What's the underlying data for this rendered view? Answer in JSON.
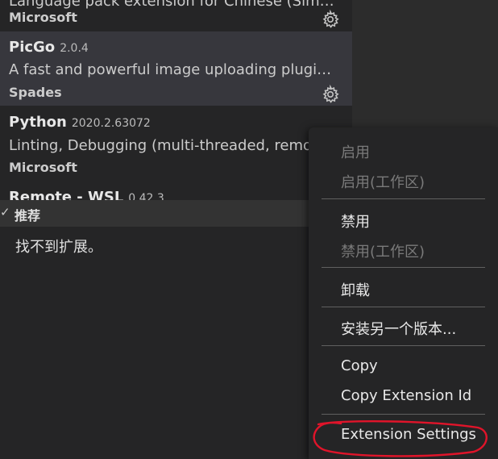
{
  "extensions": [
    {
      "name": "",
      "version": "",
      "description": "Language pack extension for Chinese (Simplified)",
      "publisher": "Microsoft",
      "icon": "gear-icon"
    },
    {
      "name": "PicGo",
      "version": "2.0.4",
      "description": "A fast and powerful image uploading plugin f...",
      "publisher": "Spades",
      "icon": "gear-icon"
    },
    {
      "name": "Python",
      "version": "2020.2.63072",
      "description": "Linting, Debugging (multi-threaded, remote",
      "publisher": "Microsoft"
    },
    {
      "name": "Remote - WSL",
      "version": "0.42.3"
    }
  ],
  "recommended_section": {
    "check": "✓",
    "title": "推荐",
    "empty_message": "找不到扩展。"
  },
  "context_menu": {
    "items": [
      {
        "label": "启用",
        "disabled": true
      },
      {
        "label": "启用(工作区)",
        "disabled": true
      },
      {
        "label": "禁用",
        "disabled": false
      },
      {
        "label": "禁用(工作区)",
        "disabled": true
      },
      {
        "label": "卸载",
        "disabled": false
      },
      {
        "label": "安装另一个版本...",
        "disabled": false
      },
      {
        "label": "Copy",
        "disabled": false
      },
      {
        "label": "Copy Extension Id",
        "disabled": false
      },
      {
        "label": "Extension Settings",
        "disabled": false
      }
    ]
  },
  "colors": {
    "selected_row": "#37373d",
    "annotation_circle": "#e0142a"
  }
}
